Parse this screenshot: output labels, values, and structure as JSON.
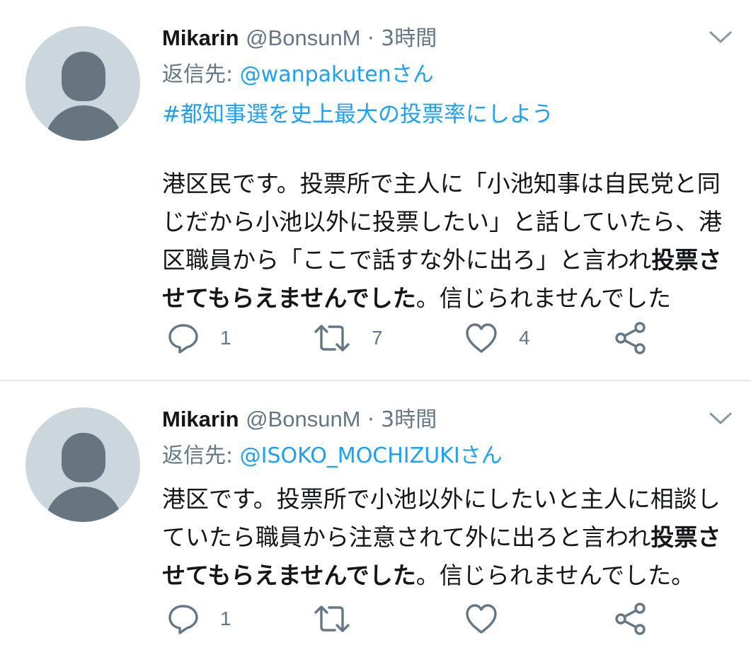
{
  "tweets": [
    {
      "name": "Mikarin",
      "handle": "@BonsunM",
      "separator": "·",
      "time": "3時間",
      "reply_label": "返信先:",
      "reply_to": "@wanpakutenさん",
      "hashtag": "#都知事選を史上最大の投票率にしよう",
      "body": [
        {
          "text": "港区民です。投票所で主人に「小池知事は自民党と同"
        },
        {
          "text": "じだから小池以外に投票したい」と話していたら、港"
        },
        {
          "text": "区職員から「ここで話すな外に出ろ」と言われ",
          "bold": "投票さ"
        },
        {
          "bold": "せてもらえませんでした",
          "text": "。信じられませんでした"
        }
      ],
      "replies": "1",
      "retweets": "7",
      "likes": "4"
    },
    {
      "name": "Mikarin",
      "handle": "@BonsunM",
      "separator": "·",
      "time": "3時間",
      "reply_label": "返信先:",
      "reply_to": "@ISOKO_MOCHIZUKIさん",
      "body": [
        {
          "text": "港区です。投票所で小池以外にしたいと主人に相談し"
        },
        {
          "text": "ていたら職員から注意されて外に出ろと言われ",
          "bold": "投票さ"
        },
        {
          "bold": "せてもらえませんでした",
          "text": "。信じられませんでした。"
        }
      ],
      "replies": "1",
      "retweets": "",
      "likes": ""
    }
  ],
  "colors": {
    "link": "#1da1f2",
    "secondary": "#657786",
    "text": "#14171a",
    "avatar_bg": "#ccd6dd",
    "avatar_fg": "#66757f"
  },
  "icons": [
    "avatar-placeholder",
    "chevron-down-icon",
    "reply-icon",
    "retweet-icon",
    "like-icon",
    "share-icon"
  ]
}
